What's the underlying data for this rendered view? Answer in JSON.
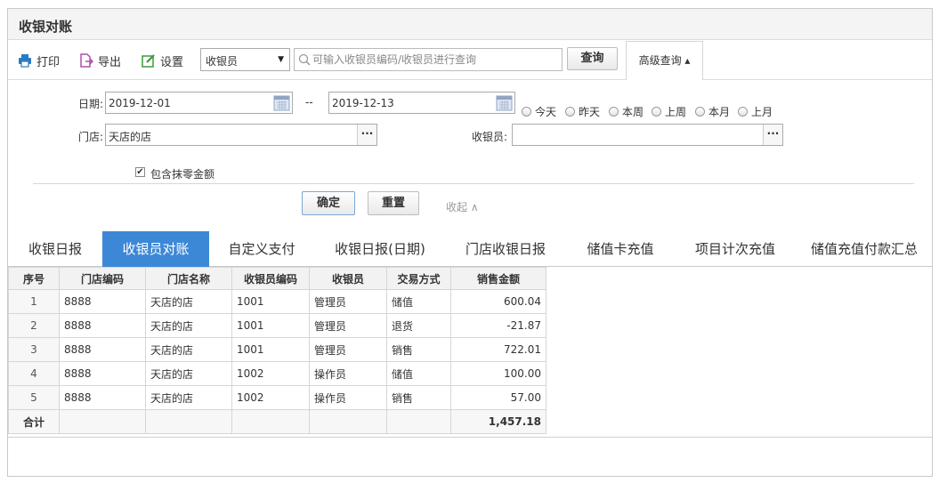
{
  "page": {
    "title": "收银对账"
  },
  "toolbar": {
    "print_label": "打印",
    "export_label": "导出",
    "settings_label": "设置",
    "search_type": "收银员",
    "search_placeholder": "可输入收银员编码/收银员进行查询",
    "query_label": "查询",
    "advanced_label": "高级查询 ▴"
  },
  "filter": {
    "date_label": "日期:",
    "date_from": "2019-12-01",
    "date_sep": "--",
    "date_to": "2019-12-13",
    "quick_ranges": [
      "今天",
      "昨天",
      "本周",
      "上周",
      "本月",
      "上月"
    ],
    "store_label": "门店:",
    "store_value": "天店的店",
    "cashier_label": "收银员:",
    "cashier_value": "",
    "include_rounding_label": "包含抹零金额",
    "include_rounding_checked": true,
    "confirm_label": "确定",
    "reset_label": "重置",
    "collapse_label": "收起 ∧"
  },
  "tabs": [
    {
      "label": "收银日报",
      "active": false
    },
    {
      "label": "收银员对账",
      "active": true
    },
    {
      "label": "自定义支付",
      "active": false
    },
    {
      "label": "收银日报(日期)",
      "active": false
    },
    {
      "label": "门店收银日报",
      "active": false
    },
    {
      "label": "储值卡充值",
      "active": false
    },
    {
      "label": "项目计次充值",
      "active": false
    },
    {
      "label": "储值充值付款汇总",
      "active": false
    }
  ],
  "table": {
    "columns": [
      "序号",
      "门店编码",
      "门店名称",
      "收银员编码",
      "收银员",
      "交易方式",
      "销售金额"
    ],
    "rows": [
      [
        "1",
        "8888",
        "天店的店",
        "1001",
        "管理员",
        "储值",
        "600.04"
      ],
      [
        "2",
        "8888",
        "天店的店",
        "1001",
        "管理员",
        "退货",
        "-21.87"
      ],
      [
        "3",
        "8888",
        "天店的店",
        "1001",
        "管理员",
        "销售",
        "722.01"
      ],
      [
        "4",
        "8888",
        "天店的店",
        "1002",
        "操作员",
        "储值",
        "100.00"
      ],
      [
        "5",
        "8888",
        "天店的店",
        "1002",
        "操作员",
        "销售",
        "57.00"
      ]
    ],
    "summary": {
      "label": "合计",
      "total": "1,457.18"
    }
  },
  "colors": {
    "active_tab": "#3d88d6",
    "print_icon": "#2b7bc0",
    "export_icon": "#b04fb0",
    "settings_icon": "#3a9a3a"
  }
}
